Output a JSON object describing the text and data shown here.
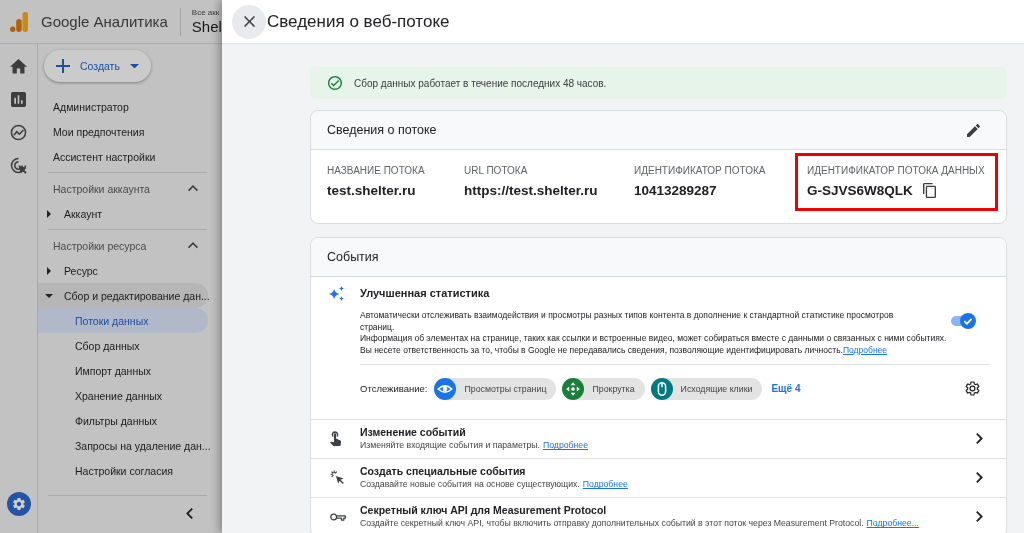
{
  "sidebar": {
    "header": {
      "product_name": "Google Аналитика",
      "account_label": "Все акк",
      "account_name": "Shel"
    },
    "create_button": {
      "label": "Создать"
    },
    "top_items": [
      {
        "label": "Администратор",
        "selected": false
      },
      {
        "label": "Мои предпочтения",
        "selected": false
      },
      {
        "label": "Ассистент настройки",
        "selected": false
      }
    ],
    "sections": [
      {
        "title": "Настройки аккаунта",
        "expanded": true,
        "items": [
          {
            "label": "Аккаунт",
            "expanded": false,
            "selected": false
          }
        ]
      },
      {
        "title": "Настройки ресурса",
        "expanded": true,
        "items": [
          {
            "label": "Ресурс",
            "expanded": false,
            "selected": false
          },
          {
            "label": "Сбор и редактирование дан...",
            "expanded": true,
            "selected": false,
            "children": [
              {
                "label": "Потоки данных",
                "selected": true
              },
              {
                "label": "Сбор данных",
                "selected": false
              },
              {
                "label": "Импорт данных",
                "selected": false
              },
              {
                "label": "Хранение данных",
                "selected": false
              },
              {
                "label": "Фильтры данных",
                "selected": false
              },
              {
                "label": "Запросы на удаление дан...",
                "selected": false
              },
              {
                "label": "Настройки согласия",
                "selected": false
              }
            ]
          }
        ]
      }
    ]
  },
  "panel": {
    "title": "Сведения о веб-потоке",
    "status_banner": {
      "text": "Сбор данных работает в течение последних 48 часов."
    },
    "stream_details": {
      "title": "Сведения о потоке",
      "fields": [
        {
          "label": "НАЗВАНИЕ ПОТОКА",
          "value": "test.shelter.ru",
          "copyable": false,
          "highlighted": false
        },
        {
          "label": "URL ПОТОКА",
          "value": "https://test.shelter.ru",
          "copyable": false,
          "highlighted": false
        },
        {
          "label": "ИДЕНТИФИКАТОР ПОТОКА",
          "value": "10413289287",
          "copyable": false,
          "highlighted": false
        },
        {
          "label": "ИДЕНТИФИКАТОР ПОТОКА ДАННЫХ",
          "value": "G-SJVS6W8QLK",
          "copyable": true,
          "highlighted": true
        }
      ]
    },
    "events": {
      "title": "События",
      "enhanced_measurement": {
        "title": "Улучшенная статистика",
        "description": "Автоматически отслеживать взаимодействия и просмотры разных типов контента в дополнение к стандартной статистике просмотров страниц.",
        "note": "Информация об элементах на странице, таких как ссылки и встроенные видео, может собираться вместе с данными о связанных с ними событиях. Вы несете ответственность за то, чтобы в Google не передавались сведения, позволяющие идентифицировать личность.",
        "note_link": "Подробнее",
        "on": true,
        "tracking_label": "Отслеживание:",
        "chips": [
          {
            "kind": "pageview",
            "label": "Просмотры страниц",
            "color": "#1a73e8"
          },
          {
            "kind": "scroll",
            "label": "Прокрутка",
            "color": "#188038"
          },
          {
            "kind": "click",
            "label": "Исходящие клики",
            "color": "#007b83"
          }
        ],
        "more_link": "Ещё 4"
      },
      "rows": [
        {
          "kind": "modify",
          "title": "Изменение событий",
          "description": "Изменяйте входящие события и параметры.",
          "link": "Подробнее"
        },
        {
          "kind": "create",
          "title": "Создать специальные события",
          "description": "Создавайте новые события на основе существующих.",
          "link": "Подробнее"
        },
        {
          "kind": "key",
          "title": "Секретный ключ API для Measurement Protocol",
          "description": "Создайте секретный ключ API, чтобы включить отправку дополнительных событий в этот поток через Measurement Protocol.",
          "link": "Подробнее..."
        }
      ]
    }
  }
}
